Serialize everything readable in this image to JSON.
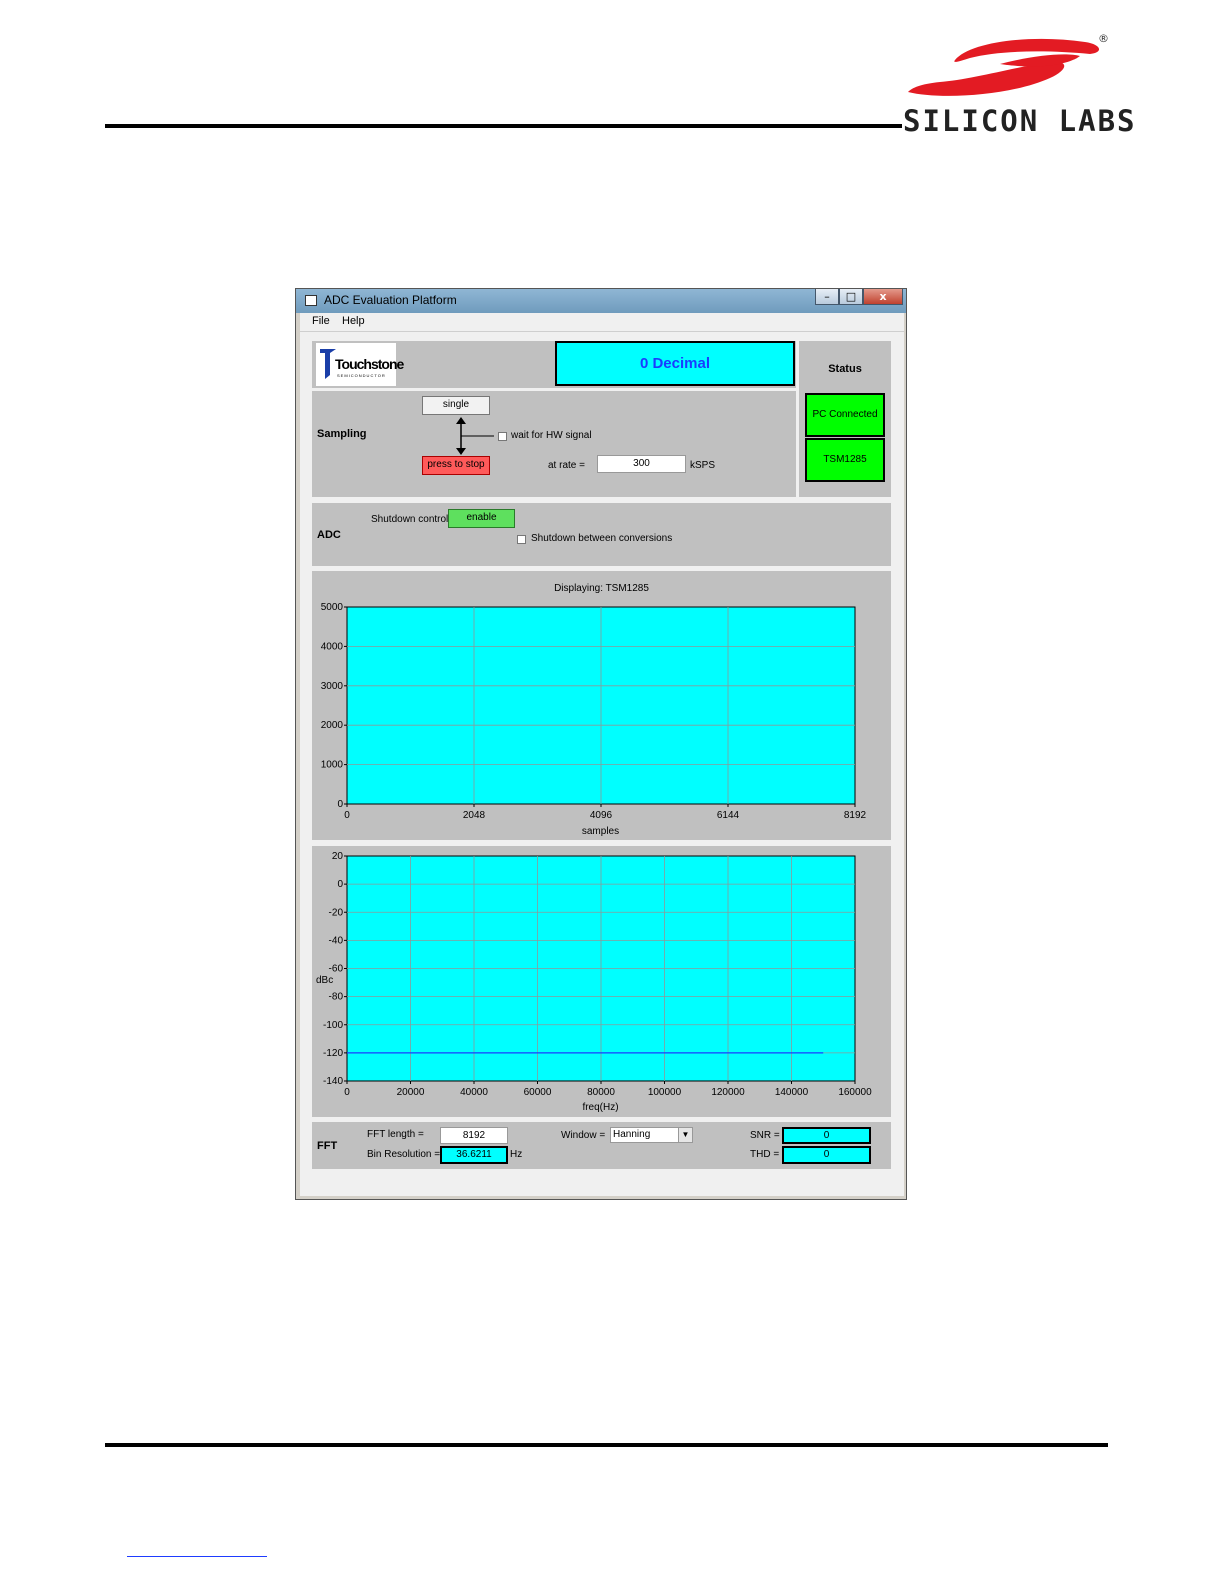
{
  "page": {
    "brand": "SILICON LABS",
    "registered": "®"
  },
  "window": {
    "title": "ADC Evaluation Platform",
    "controls": {
      "minimize": "–",
      "maximize": "□",
      "close": "x"
    },
    "menu": [
      "File",
      "Help"
    ]
  },
  "top": {
    "touchstone_logo": "Touchstone",
    "touchstone_sub": "SEMICONDUCTOR",
    "display_mode": "0 Decimal"
  },
  "status": {
    "title": "Status",
    "pc": "PC Connected",
    "device": "TSM1285",
    "color": "#00ff00"
  },
  "sampling": {
    "title": "Sampling",
    "single_label": "single",
    "stop_label": "press to stop",
    "hw_signal_label": "wait for HW signal",
    "hw_signal_checked": false,
    "rate_label": "at rate =",
    "rate_value": "300",
    "rate_unit": "kSPS"
  },
  "adc": {
    "title": "ADC",
    "shutdown_label": "Shutdown control",
    "shutdown_value": "enable",
    "between_label": "Shutdown between conversions",
    "between_checked": false
  },
  "time_chart": {
    "title": "Displaying: TSM1285",
    "xlabel": "samples"
  },
  "fft_chart": {
    "ylabel": "dBc",
    "xlabel": "freq(Hz)"
  },
  "chart_data": [
    {
      "type": "line",
      "title": "Displaying: TSM1285",
      "xlabel": "samples",
      "ylabel": "",
      "xlim": [
        0,
        8192
      ],
      "ylim": [
        0,
        5000
      ],
      "x_ticks": [
        "0",
        "2048",
        "4096",
        "6144",
        "8192"
      ],
      "y_ticks": [
        "0",
        "1000",
        "2000",
        "3000",
        "4000",
        "5000"
      ],
      "grid": true,
      "background": "#00ffff",
      "series": []
    },
    {
      "type": "line",
      "title": "",
      "xlabel": "freq(Hz)",
      "ylabel": "dBc",
      "xlim": [
        0,
        160000
      ],
      "ylim": [
        -140,
        20
      ],
      "x_ticks": [
        "0",
        "20000",
        "40000",
        "60000",
        "80000",
        "100000",
        "120000",
        "140000",
        "160000"
      ],
      "y_ticks": [
        "20",
        "0",
        "-20",
        "-40",
        "-60",
        "-80",
        "-100",
        "-120",
        "-140"
      ],
      "grid": true,
      "background": "#00ffff",
      "series": [
        {
          "x": [
            0,
            150000
          ],
          "y": [
            -120,
            -120
          ],
          "color": "#1a3cff"
        }
      ]
    }
  ],
  "fft": {
    "title": "FFT",
    "length_label": "FFT length =",
    "length_value": "8192",
    "bin_label": "Bin Resolution =",
    "bin_value": "36.6211",
    "bin_unit": "Hz",
    "window_label": "Window =",
    "window_value": "Hanning",
    "snr_label": "SNR =",
    "snr_value": "0",
    "thd_label": "THD =",
    "thd_value": "0"
  }
}
